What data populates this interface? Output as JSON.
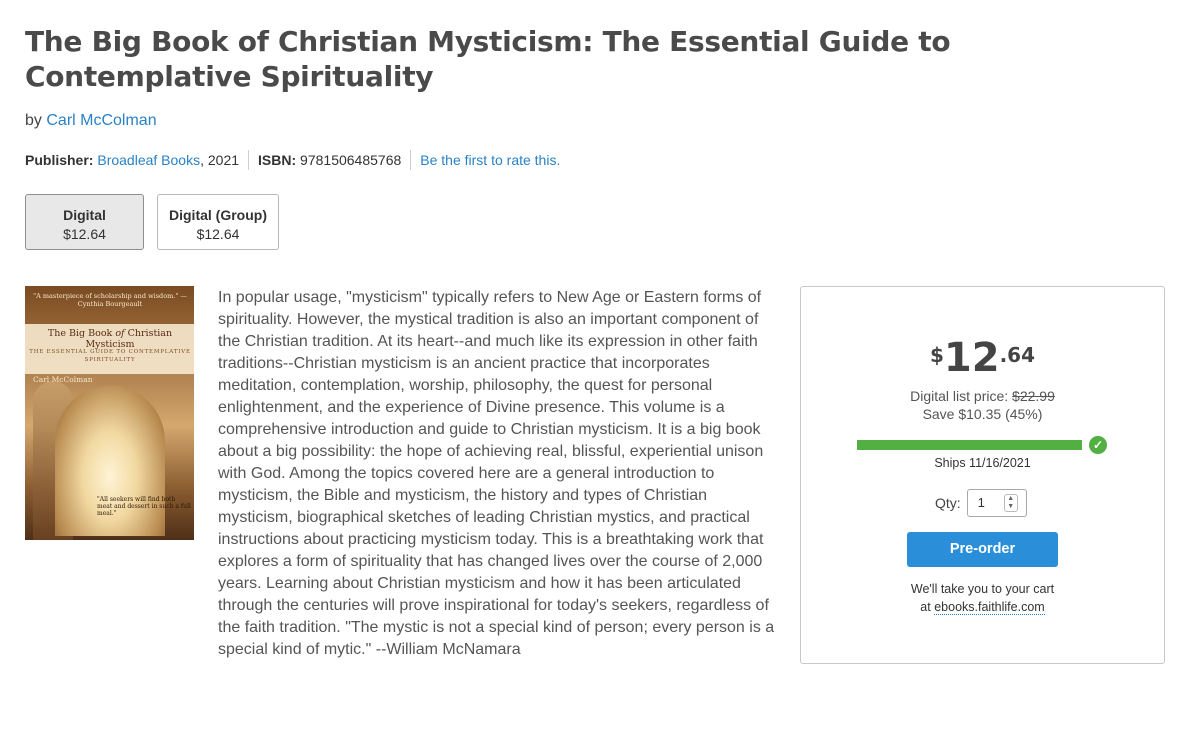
{
  "product": {
    "title": "The Big Book of Christian Mysticism: The Essential Guide to Contemplative Spirituality",
    "by_label": "by",
    "author": "Carl McColman"
  },
  "meta": {
    "publisher_label": "Publisher:",
    "publisher": "Broadleaf Books",
    "year": ", 2021",
    "isbn_label": "ISBN:",
    "isbn": "9781506485768",
    "rate_link": "Be the first to rate this."
  },
  "formats": [
    {
      "name": "Digital",
      "price": "$12.64",
      "selected": true
    },
    {
      "name": "Digital (Group)",
      "price": "$12.64",
      "selected": false
    }
  ],
  "cover": {
    "praise": "\"A masterpiece of scholarship and wisdom.\" —Cynthia Bourgeault",
    "title_pre": "The Big Book ",
    "title_of": "of",
    "title_post": " Christian Mysticism",
    "subtitle": "THE ESSENTIAL GUIDE TO CONTEMPLATIVE SPIRITUALITY",
    "author": "Carl McColman",
    "quote": "\"All seekers will find both meat and dessert in such a full meal.\""
  },
  "description": "In popular usage, \"mysticism\" typically refers to New Age or Eastern forms of spirituality. However, the mystical tradition is also an important component of the Christian tradition. At its heart--and much like its expression in other faith traditions--Christian mysticism is an ancient practice that incorporates meditation, contemplation, worship, philosophy, the quest for personal enlightenment, and the experience of Divine presence. This volume is a comprehensive introduction and guide to Christian mysticism. It is a big book about a big possibility: the hope of achieving real, blissful, experiential unison with God. Among the topics covered here are a general introduction to mysticism, the Bible and mysticism, the history and types of Christian mysticism, biographical sketches of leading Christian mystics, and practical instructions about practicing mysticism today. This is a breathtaking work that explores a form of spirituality that has changed lives over the course of 2,000 years. Learning about Christian mysticism and how it has been articulated through the centuries will prove inspirational for today's seekers, regardless of the faith tradition. \"The mystic is not a special kind of person; every person is a special kind of mytic.\" --William McNamara",
  "purchase": {
    "currency": "$",
    "dollars": "12",
    "cents": ".64",
    "list_price_label": "Digital list price:",
    "list_price": "$22.99",
    "save_text": "Save $10.35 (45%)",
    "availability_progress": 1.0,
    "ships_text": "Ships 11/16/2021",
    "qty_label": "Qty:",
    "qty_value": "1",
    "preorder_label": "Pre-order",
    "cart_note_line1": "We'll take you to your cart",
    "cart_note_at": "at",
    "cart_link": "ebooks.faithlife.com",
    "colors": {
      "accent": "#2a8fd8",
      "success": "#52b043",
      "link": "#2a82c5"
    }
  }
}
